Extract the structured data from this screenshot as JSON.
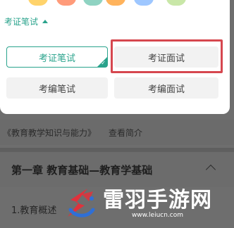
{
  "panel": {
    "header_label": "考证笔试",
    "options": [
      {
        "label": "考证笔试",
        "selected": true
      },
      {
        "label": "考证面试",
        "selected": false,
        "highlighted": true
      },
      {
        "label": "考编笔试",
        "selected": false
      },
      {
        "label": "考编面试",
        "selected": false
      }
    ]
  },
  "background": {
    "book_title": "《教育教学知识与能力》",
    "intro_link": "查看简介",
    "chapter_title": "第一章 教育基础—教育学基础",
    "section_title": "1.教育概述"
  },
  "watermark": {
    "title": "雷羽手游网",
    "url": "www.leiucn.com"
  },
  "colors": {
    "accent": "#2aa38c",
    "highlight": "#d6474f",
    "logo_red": "#e0323c",
    "logo_blue": "#2f6fd6"
  }
}
